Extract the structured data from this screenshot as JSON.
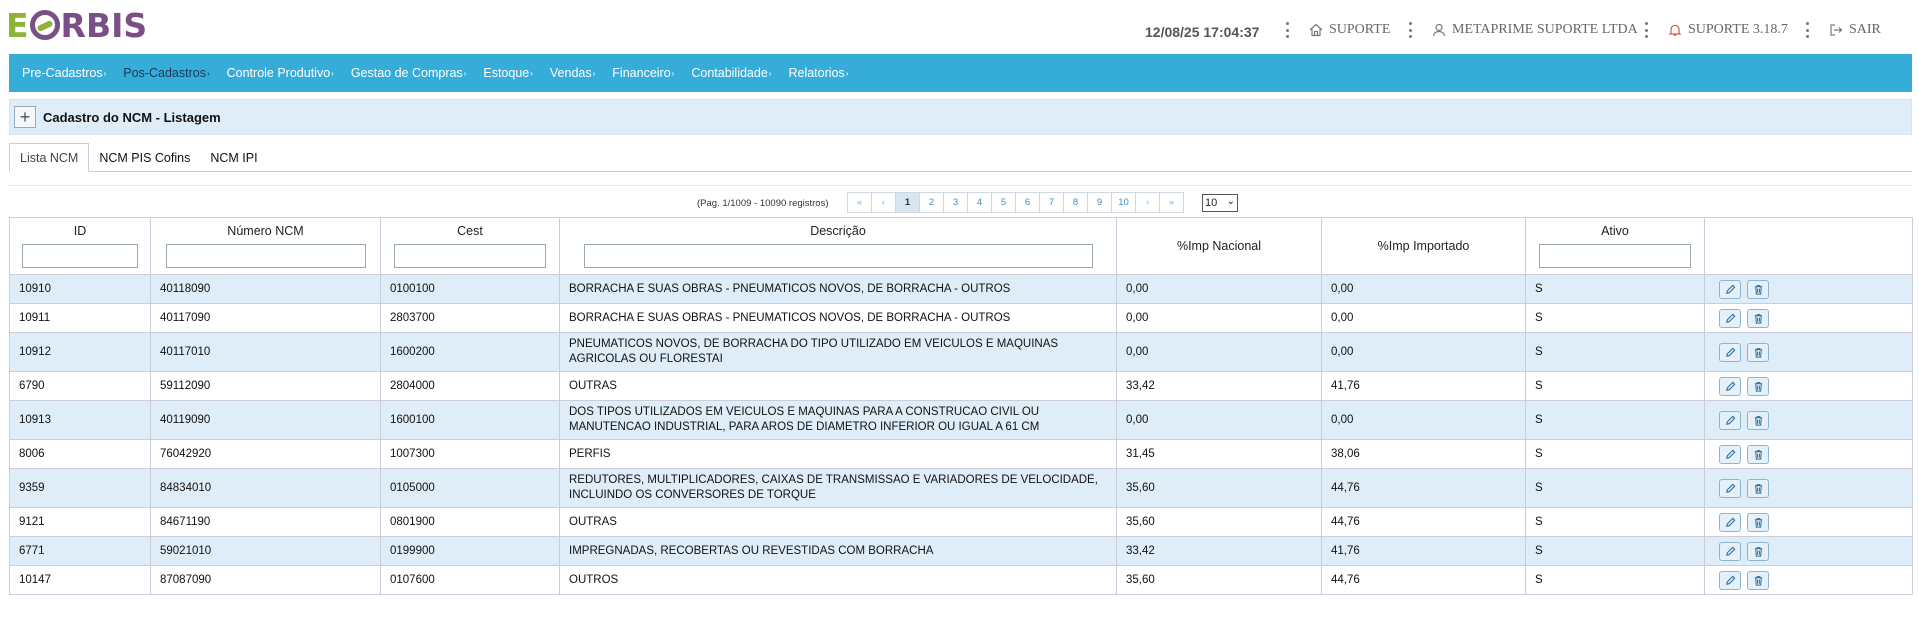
{
  "logo": {
    "e": "E",
    "rest": "RBIS"
  },
  "header": {
    "datetime": "12/08/25 17:04:37",
    "suporte": "SUPORTE",
    "company": "METAPRIME SUPORTE LTDA",
    "version": "SUPORTE 3.18.7",
    "logout": "SAIR"
  },
  "menu": [
    "Pre-Cadastros",
    "Pos-Cadastros",
    "Controle Produtivo",
    "Gestao de Compras",
    "Estoque",
    "Vendas",
    "Financeiro",
    "Contabilidade",
    "Relatorios"
  ],
  "panel": {
    "title": "Cadastro do NCM - Listagem"
  },
  "tabs": [
    "Lista NCM",
    "NCM PIS Cofins",
    "NCM IPI"
  ],
  "pagination": {
    "info": "(Pag. 1/1009 - 10090 registros)",
    "first": "«",
    "prev": "‹",
    "pages": [
      "1",
      "2",
      "3",
      "4",
      "5",
      "6",
      "7",
      "8",
      "9",
      "10"
    ],
    "next": "›",
    "last": "»",
    "page_size": "10"
  },
  "table": {
    "columns": [
      "ID",
      "Número NCM",
      "Cest",
      "Descrição",
      "%Imp Nacional",
      "%Imp Importado",
      "Ativo",
      ""
    ],
    "rows": [
      [
        "10910",
        "40118090",
        "0100100",
        "BORRACHA E SUAS OBRAS - PNEUMATICOS NOVOS, DE BORRACHA - OUTROS",
        "0,00",
        "0,00",
        "S"
      ],
      [
        "10911",
        "40117090",
        "2803700",
        "BORRACHA E SUAS OBRAS - PNEUMATICOS NOVOS, DE BORRACHA - OUTROS",
        "0,00",
        "0,00",
        "S"
      ],
      [
        "10912",
        "40117010",
        "1600200",
        "PNEUMATICOS NOVOS, DE BORRACHA DO TIPO UTILIZADO EM VEICULOS E MAQUINAS AGRICOLAS OU FLORESTAI",
        "0,00",
        "0,00",
        "S"
      ],
      [
        "6790",
        "59112090",
        "2804000",
        "OUTRAS",
        "33,42",
        "41,76",
        "S"
      ],
      [
        "10913",
        "40119090",
        "1600100",
        "DOS TIPOS UTILIZADOS EM VEICULOS E MAQUINAS PARA A CONSTRUCAO CIVIL OU MANUTENCAO INDUSTRIAL, PARA AROS DE DIAMETRO INFERIOR OU IGUAL A 61 CM",
        "0,00",
        "0,00",
        "S"
      ],
      [
        "8006",
        "76042920",
        "1007300",
        "PERFIS",
        "31,45",
        "38,06",
        "S"
      ],
      [
        "9359",
        "84834010",
        "0105000",
        "REDUTORES, MULTIPLICADORES, CAIXAS DE TRANSMISSAO E VARIADORES DE VELOCIDADE, INCLUINDO OS CONVERSORES DE TORQUE",
        "35,60",
        "44,76",
        "S"
      ],
      [
        "9121",
        "84671190",
        "0801900",
        "OUTRAS",
        "35,60",
        "44,76",
        "S"
      ],
      [
        "6771",
        "59021010",
        "0199900",
        "IMPREGNADAS, RECOBERTAS OU REVESTIDAS COM BORRACHA",
        "33,42",
        "41,76",
        "S"
      ],
      [
        "10147",
        "87087090",
        "0107600",
        "OUTROS",
        "35,60",
        "44,76",
        "S"
      ]
    ]
  },
  "colors": {
    "menubar": "#36acd9",
    "row_alt": "#dfedf8",
    "logo_green": "#8fb339",
    "logo_purple": "#7a4f86"
  }
}
